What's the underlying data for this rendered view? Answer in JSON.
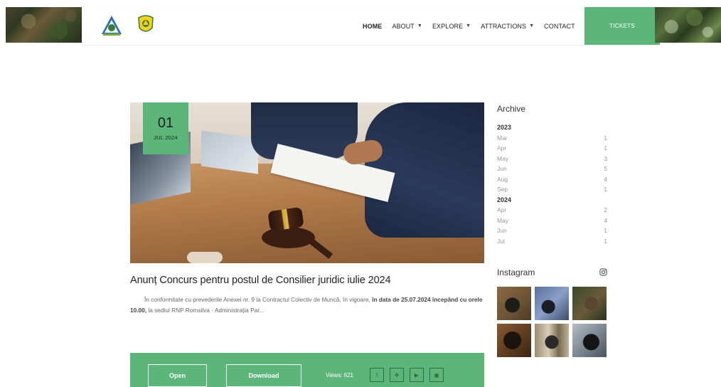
{
  "header": {
    "nav": [
      {
        "label": "HOME",
        "has_caret": false,
        "active": true
      },
      {
        "label": "ABOUT",
        "has_caret": true,
        "active": false
      },
      {
        "label": "EXPLORE",
        "has_caret": true,
        "active": false
      },
      {
        "label": "ATTRACTIONS",
        "has_caret": true,
        "active": false
      },
      {
        "label": "CONTACT",
        "has_caret": false,
        "active": false
      }
    ],
    "tickets_label": "TICKETS",
    "colors": {
      "accent": "#5cb67a"
    }
  },
  "post": {
    "date_day": "01",
    "date_month": "JUL 2024",
    "title": "Anunț Concurs pentru postul de Consilier juridic iulie 2024",
    "excerpt_part1": "În conformitate cu prevederile Anexei nr. 9 la Contractul Colectiv de Muncă, în vigoare, ",
    "excerpt_bold": "în data de 25.07.2024 începând cu orele 10.00,",
    "excerpt_part2": " la sediul RNP Romsilva - Administrația Par...",
    "open_label": "Open",
    "download_label": "Download",
    "views_text": "Views: 621",
    "share_icons": [
      "facebook-icon",
      "twitter-icon",
      "youtube-icon",
      "instagram-icon"
    ]
  },
  "sidebar": {
    "archive_title": "Archive",
    "archive": [
      {
        "year": "2023",
        "months": [
          {
            "month": "Mar",
            "count": "1"
          },
          {
            "month": "Apr",
            "count": "1"
          },
          {
            "month": "May",
            "count": "3"
          },
          {
            "month": "Jun",
            "count": "5"
          },
          {
            "month": "Aug",
            "count": "4"
          },
          {
            "month": "Sep",
            "count": "1"
          }
        ]
      },
      {
        "year": "2024",
        "months": [
          {
            "month": "Apr",
            "count": "2"
          },
          {
            "month": "May",
            "count": "4"
          },
          {
            "month": "Jun",
            "count": "1"
          },
          {
            "month": "Jul",
            "count": "1"
          }
        ]
      }
    ],
    "instagram_title": "Instagram",
    "instagram_icon": "instagram-icon"
  }
}
